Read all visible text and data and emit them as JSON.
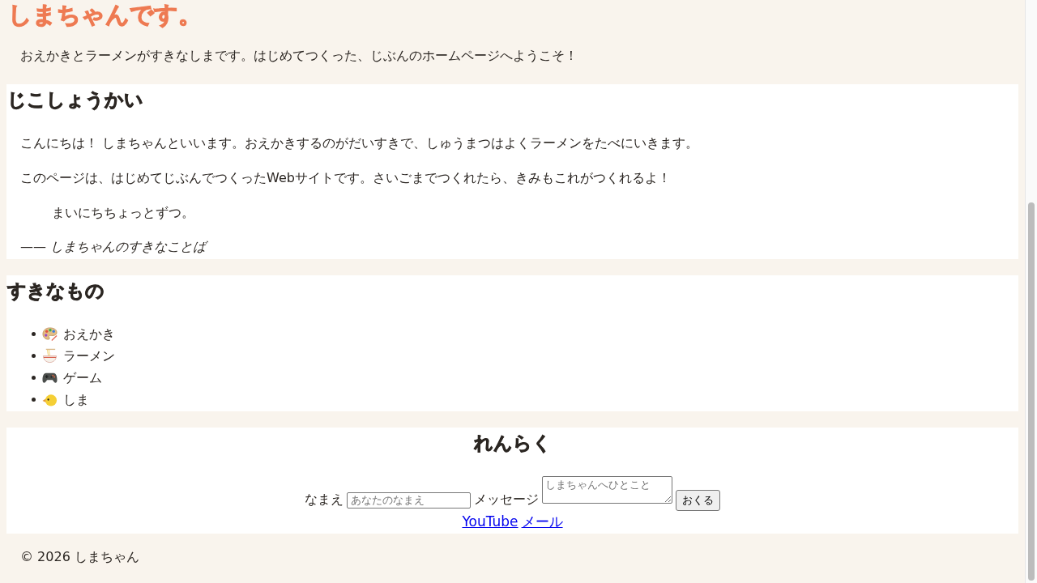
{
  "header": {
    "title": "しまちゃんです。",
    "intro": "おえかきとラーメンがすきなしまです。はじめてつくった、じぶんのホームページへようこそ！"
  },
  "about": {
    "heading": "じこしょうかい",
    "paragraphs": [
      "こんにちは！ しまちゃんといいます。おえかきするのがだいすきで、しゅうまつはよくラーメンをたべにいきます。",
      "このページは、はじめてじぶんでつくったWebサイトです。さいごまでつくれたら、きみもこれがつくれるよ！"
    ],
    "quote": "まいにちちょっとずつ。",
    "citation": "—— *しまちゃんのすきなことば*"
  },
  "favorites": {
    "heading": "すきなもの",
    "items": [
      {
        "kind": "palette",
        "label": "おえかき"
      },
      {
        "kind": "ramen",
        "label": "ラーメン"
      },
      {
        "kind": "game",
        "label": "ゲーム"
      },
      {
        "kind": "chick",
        "label": "しま"
      }
    ]
  },
  "contact": {
    "heading": "れんらく",
    "fields": [
      {
        "kind": "input",
        "label": "なまえ",
        "placeholder": "あなたのなまえ"
      },
      {
        "kind": "textarea",
        "label": "メッセージ",
        "placeholder": "しまちゃんへひとこと"
      }
    ],
    "submit": "おくる",
    "links": [
      "YouTube",
      "メール"
    ]
  },
  "footer": {
    "copyright": "© 2026 しまちゃん"
  }
}
